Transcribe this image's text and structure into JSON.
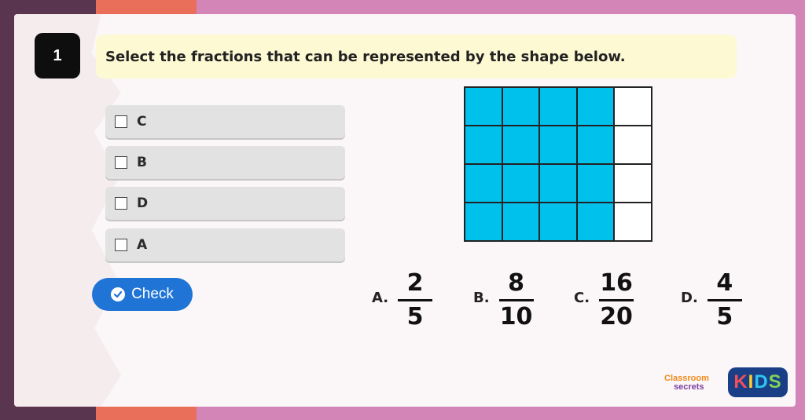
{
  "question": {
    "number": "1",
    "prompt": "Select the fractions that can be represented by the shape below."
  },
  "options": [
    {
      "label": "C",
      "checked": false
    },
    {
      "label": "B",
      "checked": false
    },
    {
      "label": "D",
      "checked": false
    },
    {
      "label": "A",
      "checked": false
    }
  ],
  "check_button": {
    "label": "Check",
    "icon": "check-circle-icon"
  },
  "shape": {
    "columns": 5,
    "rows": 4,
    "shaded_columns": 4,
    "shaded_color": "#00c0ec",
    "unshaded_color": "#ffffff"
  },
  "choices": [
    {
      "letter": "A.",
      "numerator": "2",
      "denominator": "5"
    },
    {
      "letter": "B.",
      "numerator": "8",
      "denominator": "10"
    },
    {
      "letter": "C.",
      "numerator": "16",
      "denominator": "20"
    },
    {
      "letter": "D.",
      "numerator": "4",
      "denominator": "5"
    }
  ],
  "branding": {
    "classroom_line1": "Classroom",
    "classroom_line2": "secrets",
    "kids_letters": [
      "K",
      "I",
      "D",
      "S"
    ],
    "kids_colors": [
      "#f24f5b",
      "#ffcf2a",
      "#2ec4f0",
      "#7fd35a"
    ]
  },
  "colors": {
    "accent_blue": "#1f74d6",
    "prompt_bg": "#fdf9d3"
  }
}
